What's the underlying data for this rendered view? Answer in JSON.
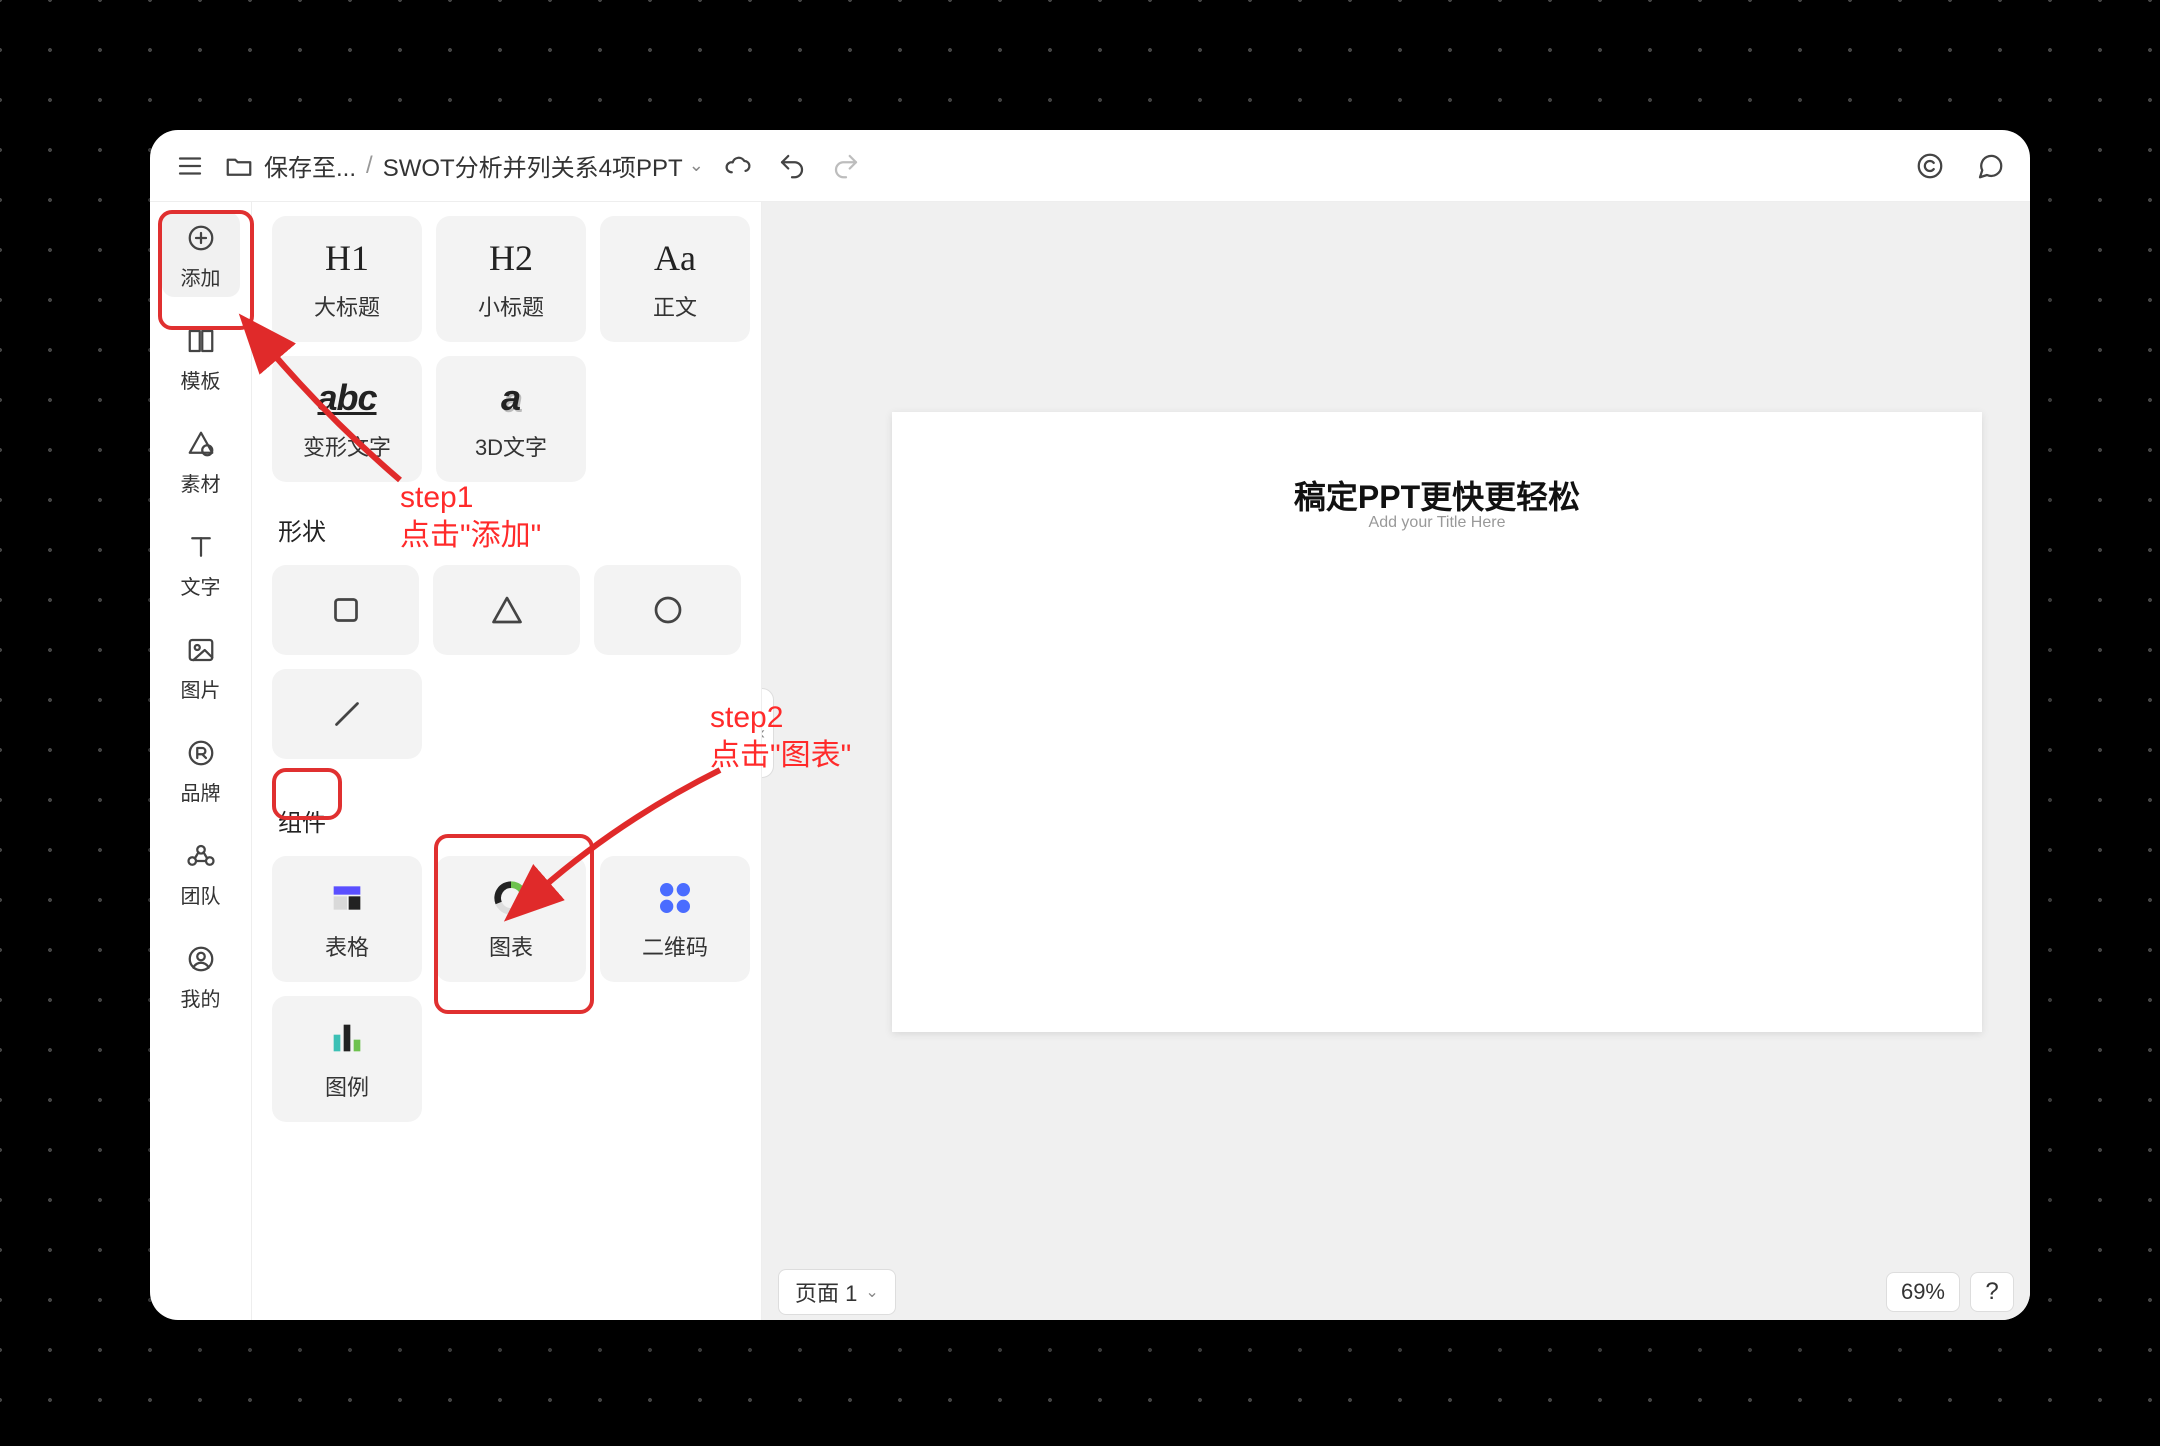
{
  "topbar": {
    "save_to": "保存至...",
    "doc_title": "SWOT分析并列关系4项PPT"
  },
  "rail": {
    "add": "添加",
    "template": "模板",
    "material": "素材",
    "text": "文字",
    "image": "图片",
    "brand": "品牌",
    "team": "团队",
    "mine": "我的"
  },
  "panel": {
    "text_cards": {
      "h1_icon": "H1",
      "h1": "大标题",
      "h2_icon": "H2",
      "h2": "小标题",
      "aa_icon": "Aa",
      "body": "正文",
      "warp_icon": "abc",
      "warp": "变形文字",
      "d3_icon": "a",
      "d3": "3D文字"
    },
    "shapes_title": "形状",
    "components_title": "组件",
    "components": {
      "table": "表格",
      "chart": "图表",
      "qrcode": "二维码",
      "legend": "图例"
    }
  },
  "slide": {
    "title": "稿定PPT更快更轻松",
    "subtitle": "Add your Title Here"
  },
  "bottom": {
    "page": "页面 1",
    "zoom": "69%",
    "help": "?"
  },
  "annotations": {
    "step1_a": "step1",
    "step1_b": "点击\"添加\"",
    "step2_a": "step2",
    "step2_b": "点击\"图表\""
  }
}
